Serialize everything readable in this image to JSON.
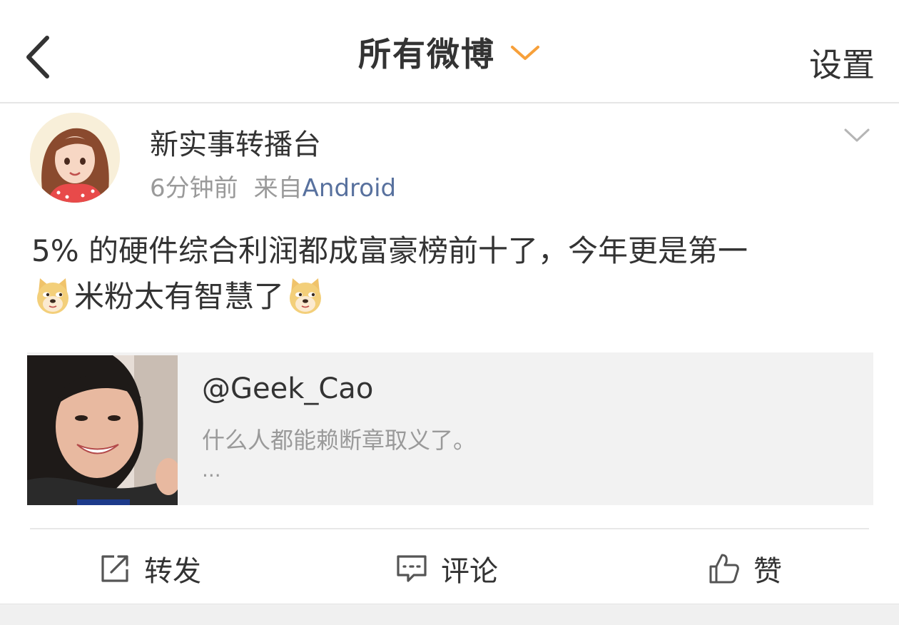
{
  "header": {
    "title": "所有微博",
    "settings_label": "设置",
    "accent_color": "#f7a03a"
  },
  "post": {
    "username": "新实事转播台",
    "time": "6分钟前",
    "source_prefix": "来自",
    "source_name": "Android",
    "text_line1": "5% 的硬件综合利润都成富豪榜前十了，今年更是第一",
    "text_line2": "米粉太有智慧了",
    "emoji_name": "doge-emoji"
  },
  "quoted": {
    "handle": "@Geek_Cao",
    "text": "什么人都能赖断章取义了。",
    "more": "..."
  },
  "actions": {
    "repost_label": "转发",
    "comment_label": "评论",
    "like_label": "赞"
  }
}
